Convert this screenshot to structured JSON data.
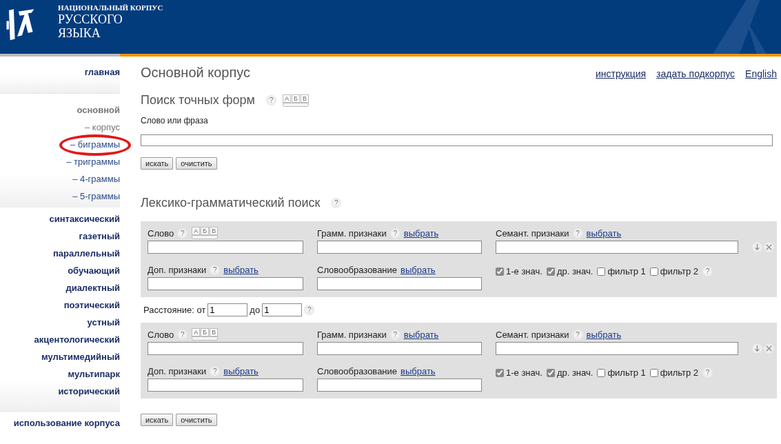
{
  "header": {
    "title_top": "НАЦИОНАЛЬНЫЙ КОРПУС",
    "title_middle": "РУССКОГО",
    "title_bottom": "ЯЗЫКА"
  },
  "sidebar": {
    "home": "главная",
    "section": {
      "label": "основной",
      "items": [
        {
          "label": "– корпус",
          "selected": true,
          "circled": false
        },
        {
          "label": "– биграммы",
          "selected": false,
          "circled": true
        },
        {
          "label": "– триграммы",
          "selected": false,
          "circled": false
        },
        {
          "label": "– 4-граммы",
          "selected": false,
          "circled": false
        },
        {
          "label": "– 5-граммы",
          "selected": false,
          "circled": false
        }
      ]
    },
    "corpora": [
      "синтаксический",
      "газетный",
      "параллельный",
      "обучающий",
      "диалектный",
      "поэтический",
      "устный",
      "акцентологический",
      "мультимедийный",
      "мультипарк",
      "исторический"
    ],
    "footer": "использование корпуса"
  },
  "page_title": "Основной корпус",
  "top_links": [
    "инструкция",
    "задать подкорпус",
    "English"
  ],
  "exact_search": {
    "title": "Поиск точных форм",
    "help": "?",
    "keyboard_keys": [
      "А",
      "Б",
      "В"
    ],
    "field_label": "Слово или фраза",
    "buttons": [
      "искать",
      "очистить"
    ]
  },
  "lexgram_search": {
    "title": "Лексико-грамматический поиск",
    "help": "?",
    "blocks": [
      {
        "word": {
          "label": "Слово",
          "help": "?",
          "keyboard_keys": [
            "А",
            "Б",
            "В"
          ]
        },
        "gram": {
          "label": "Грамм. признаки",
          "help": "?",
          "link": "выбрать"
        },
        "semant": {
          "label": "Семант. признаки",
          "help": "?",
          "link": "выбрать"
        },
        "extra": {
          "label": "Доп. признаки",
          "help": "?",
          "link": "выбрать"
        },
        "deriv": {
          "label": "Словообразование",
          "link": "выбрать"
        },
        "checkboxes": [
          {
            "label": "1-е знач.",
            "checked": true
          },
          {
            "label": "др. знач.",
            "checked": true
          },
          {
            "label": "фильтр 1",
            "checked": false
          },
          {
            "label": "фильтр 2",
            "checked": false
          }
        ],
        "filter_help": "?"
      },
      {
        "word": {
          "label": "Слово",
          "help": "?",
          "keyboard_keys": [
            "А",
            "Б",
            "В"
          ]
        },
        "gram": {
          "label": "Грамм. признаки",
          "help": "?",
          "link": "выбрать"
        },
        "semant": {
          "label": "Семант. признаки",
          "help": "?",
          "link": "выбрать"
        },
        "extra": {
          "label": "Доп. признаки",
          "help": "?",
          "link": "выбрать"
        },
        "deriv": {
          "label": "Словообразование",
          "link": "выбрать"
        },
        "checkboxes": [
          {
            "label": "1-е знач.",
            "checked": true
          },
          {
            "label": "др. знач.",
            "checked": true
          },
          {
            "label": "фильтр 1",
            "checked": false
          },
          {
            "label": "фильтр 2",
            "checked": false
          }
        ],
        "filter_help": "?"
      }
    ],
    "distance": {
      "label": "Расстояние: от",
      "from": "1",
      "to_label": "до",
      "to": "1",
      "help": "?"
    },
    "buttons": [
      "искать",
      "очистить"
    ]
  }
}
